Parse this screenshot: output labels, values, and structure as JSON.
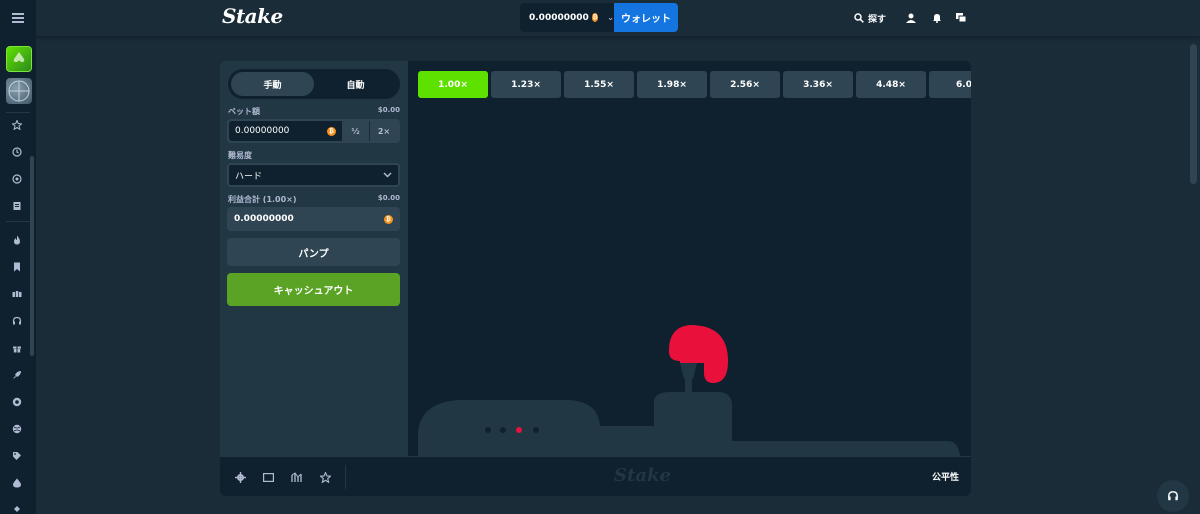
{
  "header": {
    "logo": "Stake",
    "balance": "0.00000000",
    "wallet_label": "ウォレット",
    "search_label": "探す"
  },
  "controls": {
    "tabs": [
      {
        "label": "手動"
      },
      {
        "label": "自動"
      }
    ],
    "bet_label": "ベット額",
    "bet_amount_usd": "$0.00",
    "bet_value": "0.00000000",
    "half_label": "½",
    "double_label": "2×",
    "difficulty_label": "難易度",
    "difficulty_value": "ハード",
    "profit_label": "利益合計 (1.00×)",
    "profit_amount_usd": "$0.00",
    "profit_value": "0.00000000",
    "pump_label": "パンプ",
    "cashout_label": "キャッシュアウト"
  },
  "multipliers": [
    "1.00×",
    "1.23×",
    "1.55×",
    "1.98×",
    "2.56×",
    "3.36×",
    "4.48×",
    "6.0"
  ],
  "active_multiplier": 0,
  "footer": {
    "logo": "Stake",
    "fairness_label": "公平性"
  },
  "colors": {
    "bg": "#1a2c38",
    "panel": "#213743",
    "dark": "#0f212e",
    "accent_green": "#5fe100",
    "cashout_green": "#5aa324",
    "wallet_blue": "#1475e1",
    "balloon_red": "#e9113c",
    "bitcoin": "#f7931a"
  }
}
